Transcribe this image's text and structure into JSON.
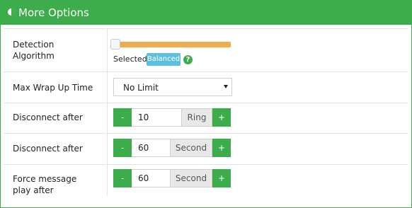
{
  "header": {
    "title": "More Options",
    "icon": "half-circle-icon"
  },
  "rows": [
    {
      "label": "Detection Algorithm",
      "slider": {
        "value_fraction": 0.0
      },
      "selected_label": "Selected:",
      "selected_value": "Balanced",
      "help_symbol": "?"
    },
    {
      "label": "Max Wrap Up Time",
      "select_value": "No Limit"
    },
    {
      "label": "Disconnect after",
      "minus": "-",
      "value": "10",
      "unit": "Ring",
      "plus": "+"
    },
    {
      "label": "Disconnect after",
      "minus": "-",
      "value": "60",
      "unit": "Second",
      "plus": "+"
    },
    {
      "label": "Force message play after",
      "minus": "-",
      "value": "60",
      "unit": "Second",
      "plus": "+"
    }
  ],
  "colors": {
    "accent": "#3cad4a",
    "slider": "#f0ad4e",
    "badge": "#5bc0de"
  }
}
